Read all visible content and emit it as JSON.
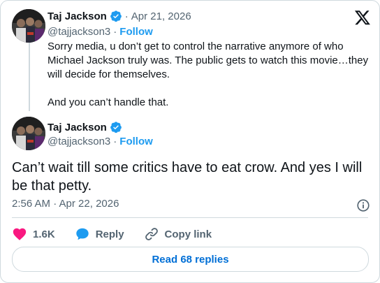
{
  "reply_tweet": {
    "author_name": "Taj Jackson",
    "handle": "@tajjackson3",
    "separator": "·",
    "date": "Apr 21, 2026",
    "follow_label": "Follow",
    "text_para1": "Sorry media, u don’t get to control the narrative anymore of who Michael Jackson truly was. The public gets to watch this movie…they will decide for themselves.",
    "text_para2": "And you can’t handle that."
  },
  "main_tweet": {
    "author_name": "Taj Jackson",
    "handle": "@tajjackson3",
    "separator": "·",
    "follow_label": "Follow",
    "text": "Can’t wait till some critics have to eat crow. And yes I will be that petty.",
    "timestamp": "2:56 AM · Apr 22, 2026"
  },
  "actions": {
    "likes_count": "1.6K",
    "reply_label": "Reply",
    "copy_link_label": "Copy link"
  },
  "read_replies_label": "Read 68 replies",
  "colors": {
    "like_pink": "#f91880",
    "reply_blue": "#1d9bf0",
    "link_blue": "#1d9bf0",
    "text_primary": "#0f1419",
    "text_secondary": "#536471",
    "border": "#cfd9de"
  },
  "icons": {
    "brand": "x-logo-icon",
    "verified": "verified-badge-icon",
    "info": "info-icon",
    "like": "heart-icon",
    "reply": "reply-bubble-icon",
    "copy_link": "link-icon"
  }
}
